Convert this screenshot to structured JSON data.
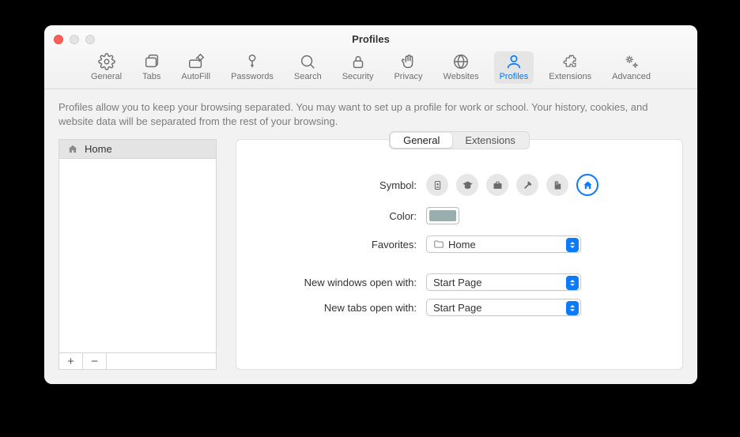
{
  "window": {
    "title": "Profiles"
  },
  "toolbar": {
    "items": [
      {
        "id": "general",
        "label": "General"
      },
      {
        "id": "tabs",
        "label": "Tabs"
      },
      {
        "id": "autofill",
        "label": "AutoFill"
      },
      {
        "id": "passwords",
        "label": "Passwords"
      },
      {
        "id": "search",
        "label": "Search"
      },
      {
        "id": "security",
        "label": "Security"
      },
      {
        "id": "privacy",
        "label": "Privacy"
      },
      {
        "id": "websites",
        "label": "Websites"
      },
      {
        "id": "profiles",
        "label": "Profiles"
      },
      {
        "id": "extensions",
        "label": "Extensions"
      },
      {
        "id": "advanced",
        "label": "Advanced"
      }
    ],
    "active": "profiles"
  },
  "description": "Profiles allow you to keep your browsing separated. You may want to set up a profile for work or school. Your history, cookies, and website data will be separated from the rest of your browsing.",
  "sidebar": {
    "items": [
      {
        "name": "Home",
        "icon": "house-icon"
      }
    ],
    "add_label": "+",
    "remove_label": "−"
  },
  "tabs": {
    "items": [
      "General",
      "Extensions"
    ],
    "active": 0
  },
  "form": {
    "symbol_label": "Symbol:",
    "symbols": [
      {
        "id": "id-card"
      },
      {
        "id": "graduation"
      },
      {
        "id": "briefcase"
      },
      {
        "id": "hammer"
      },
      {
        "id": "building"
      },
      {
        "id": "house"
      }
    ],
    "symbol_selected": "house",
    "color_label": "Color:",
    "color_value": "#9aaeb0",
    "favorites_label": "Favorites:",
    "favorites_value": "Home",
    "new_windows_label": "New windows open with:",
    "new_windows_value": "Start Page",
    "new_tabs_label": "New tabs open with:",
    "new_tabs_value": "Start Page"
  }
}
